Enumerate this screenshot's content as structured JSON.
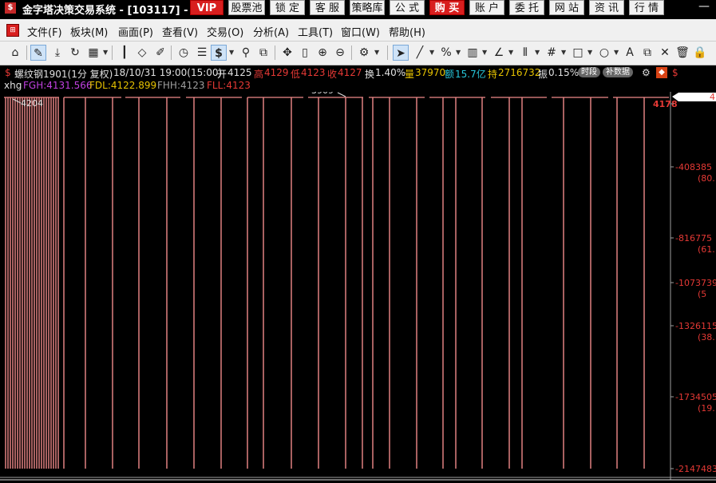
{
  "titlebar": {
    "title": "金字塔决策交易系统 - [103117] - [",
    "buttons": [
      {
        "label": "VIP",
        "style": "red"
      },
      {
        "label": "股票池",
        "style": "plain"
      },
      {
        "label": "锁 定",
        "style": "plain"
      },
      {
        "label": "客 服",
        "style": "plain"
      },
      {
        "label": "策略库",
        "style": "plain"
      },
      {
        "label": "公 式",
        "style": "plain"
      },
      {
        "label": "购 买",
        "style": "red"
      },
      {
        "label": "账 户",
        "style": "plain"
      },
      {
        "label": "委 托",
        "style": "plain"
      },
      {
        "label": "网 站",
        "style": "plain"
      },
      {
        "label": "资 讯",
        "style": "plain"
      },
      {
        "label": "行 情",
        "style": "plain"
      }
    ],
    "minimize": "—"
  },
  "menubar": {
    "items": [
      "文件(F)",
      "板块(M)",
      "画面(P)",
      "查看(V)",
      "交易(O)",
      "分析(A)",
      "工具(T)",
      "窗口(W)",
      "帮助(H)"
    ]
  },
  "toolbar": {
    "icons": [
      "home-icon",
      "pencil-link-icon",
      "download-icon",
      "refresh-dollar-icon",
      "grid-icon",
      "candlestick-icon",
      "diamond-icon",
      "edit-icon",
      "play-circle-icon",
      "list-icon",
      "dollar-icon",
      "filter-icon",
      "bracket-icon",
      "move-icon",
      "column-icon",
      "zoom-in-icon",
      "zoom-out-icon",
      "gear-icon",
      "cursor-icon",
      "line-icon",
      "percent-icon",
      "ruler-icon",
      "angle-icon",
      "parallel-icon",
      "hash-icon",
      "rectangle-icon",
      "ellipse-icon",
      "text-icon",
      "copy-icon",
      "close-icon",
      "trash-icon",
      "lock-icon"
    ],
    "dollar_symbol": "$"
  },
  "info": {
    "symbol": "螺纹钢1901(1分 复权)",
    "datetime": "18/10/31 19:00(15:00)",
    "open_label": "开",
    "open": "4125",
    "high_label": "高",
    "high": "4129",
    "low_label": "低",
    "low": "4123",
    "close_label": "收",
    "close": "4127",
    "turnover_label": "换",
    "turnover": "1.40%",
    "volume_label": "量",
    "volume": "37970",
    "amount_label": "额",
    "amount": "15.7亿",
    "hold_label": "持",
    "hold": "2716732",
    "amp_label": "振",
    "amp": "0.15%",
    "btn_period": "时段",
    "btn_supplement": "补数据"
  },
  "indicator": {
    "name": "xhg",
    "fgh": "FGH:4131.566",
    "fdl": "FDL:4122.899",
    "fhh": "FHH:4123",
    "fll": "FLL:4123"
  },
  "chart_data": {
    "type": "line",
    "y_axis_labels": [
      {
        "value": "4178",
        "sub": ""
      },
      {
        "value": "-408385",
        "sub": "(80."
      },
      {
        "value": "-816775",
        "sub": "(61."
      },
      {
        "value": "-1073739",
        "sub": "(5"
      },
      {
        "value": "-1326115",
        "sub": "(38."
      },
      {
        "value": "-1734505",
        "sub": "(19."
      },
      {
        "value": "-2147483",
        "sub": ""
      }
    ],
    "right_marker": "4",
    "top_annotations": [
      "4204",
      "3909"
    ],
    "ylim": [
      -2147483,
      4178
    ]
  },
  "colors": {
    "bar": "#f08a8a",
    "axis_red": "#e53935",
    "background": "#000000"
  }
}
